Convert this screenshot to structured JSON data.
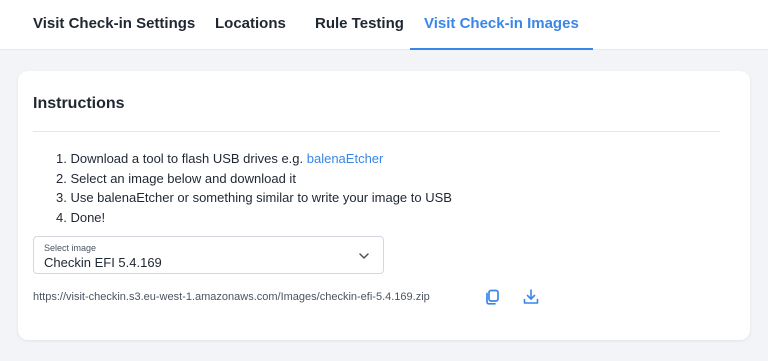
{
  "tabs": [
    {
      "label": "Visit Check-in Settings",
      "active": false
    },
    {
      "label": "Locations",
      "active": false
    },
    {
      "label": "Rule Testing",
      "active": false
    },
    {
      "label": "Visit Check-in Images",
      "active": true
    }
  ],
  "instructions": {
    "title": "Instructions",
    "steps": [
      {
        "prefix": "1. Download a tool to flash USB drives e.g. ",
        "link": "balenaEtcher"
      },
      {
        "text": "2. Select an image below and download it"
      },
      {
        "text": "3. Use balenaEtcher or something similar to write your image to USB"
      },
      {
        "text": "4. Done!"
      }
    ]
  },
  "image_select": {
    "label": "Select image",
    "value": "Checkin EFI 5.4.169"
  },
  "download": {
    "url": "https://visit-checkin.s3.eu-west-1.amazonaws.com/Images/checkin-efi-5.4.169.zip",
    "copy_icon": "copy-icon",
    "download_icon": "download-icon"
  },
  "colors": {
    "accent": "#3a86e8",
    "text": "#1f2733",
    "background": "#f2f4f7"
  }
}
